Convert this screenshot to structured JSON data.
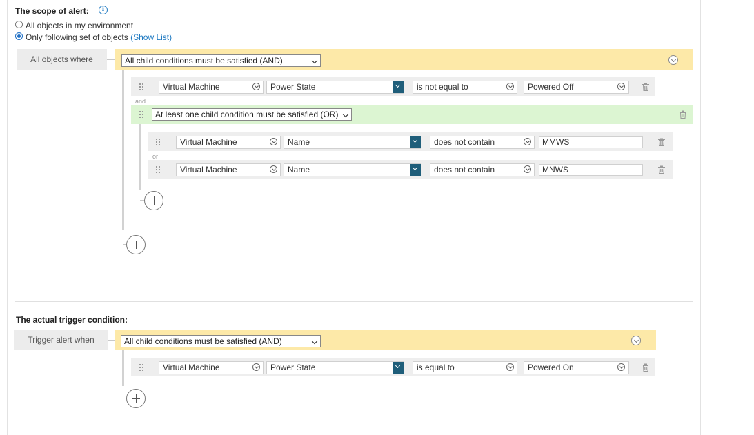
{
  "scope": {
    "title": "The scope of alert:",
    "option_all": "All objects in my environment",
    "option_following": "Only following set of objects",
    "show_list": "(Show List)",
    "selected": "following"
  },
  "scope_block": {
    "label": "All objects where",
    "group_select": "All child conditions must be satisfied (AND)",
    "rows": [
      {
        "object": "Virtual Machine",
        "property": "Power State",
        "operator": "is not equal to",
        "value": "Powered Off"
      }
    ],
    "and_label": "and",
    "subgroup": {
      "select": "At least one child condition must be satisfied (OR)",
      "or_label": "or",
      "rows": [
        {
          "object": "Virtual Machine",
          "property": "Name",
          "operator": "does not contain",
          "value": "MMWS"
        },
        {
          "object": "Virtual Machine",
          "property": "Name",
          "operator": "does not contain",
          "value": "MNWS"
        }
      ]
    }
  },
  "trigger": {
    "title": "The actual trigger condition:",
    "label": "Trigger alert when",
    "group_select": "All child conditions must be satisfied (AND)",
    "rows": [
      {
        "object": "Virtual Machine",
        "property": "Power State",
        "operator": "is equal to",
        "value": "Powered On"
      }
    ]
  },
  "icons": {
    "info": "info-icon",
    "collapse": "chevron-circle-icon",
    "drag": "drag-handle-icon",
    "delete": "trash-icon",
    "add": "plus-circle-icon"
  },
  "colors": {
    "and_bar": "#fde9a8",
    "or_bar": "#dcf5d2",
    "link": "#1f7ac2",
    "dropdown_accent": "#1f5e7a"
  }
}
